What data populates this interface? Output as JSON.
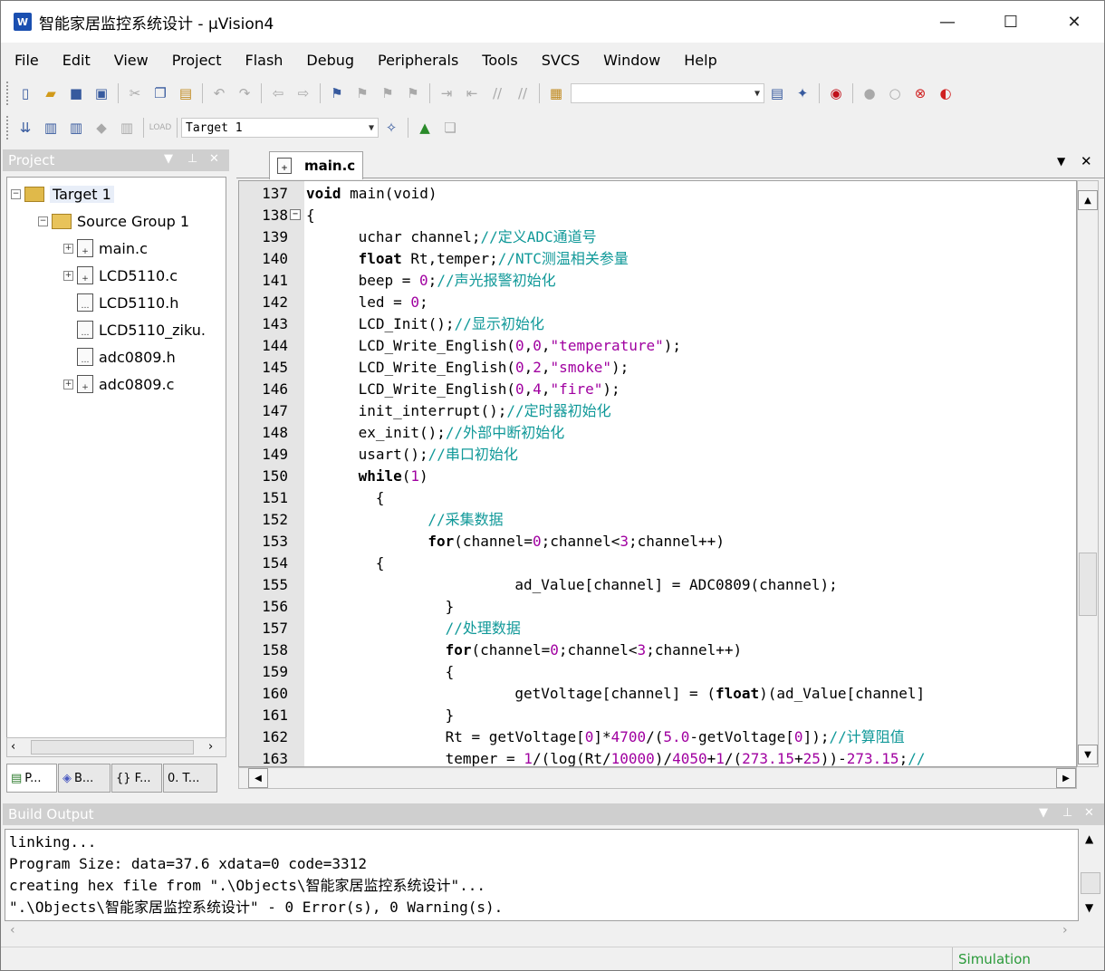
{
  "window": {
    "title": "智能家居监控系统设计  - µVision4",
    "minimize": "—",
    "maximize": "☐",
    "close": "✕"
  },
  "menu": [
    "File",
    "Edit",
    "View",
    "Project",
    "Flash",
    "Debug",
    "Peripherals",
    "Tools",
    "SVCS",
    "Window",
    "Help"
  ],
  "toolbar2": {
    "target": "Target 1"
  },
  "project_pane": {
    "title": "Project",
    "tree": [
      {
        "label": "Target 1",
        "level": 0,
        "expander": "−",
        "kind": "target"
      },
      {
        "label": "Source Group 1",
        "level": 1,
        "expander": "−",
        "kind": "folder"
      },
      {
        "label": "main.c",
        "level": 2,
        "expander": "+",
        "kind": "file"
      },
      {
        "label": "LCD5110.c",
        "level": 2,
        "expander": "+",
        "kind": "file"
      },
      {
        "label": "LCD5110.h",
        "level": 2,
        "expander": "",
        "kind": "file"
      },
      {
        "label": "LCD5110_ziku.",
        "level": 2,
        "expander": "",
        "kind": "file"
      },
      {
        "label": "adc0809.h",
        "level": 2,
        "expander": "",
        "kind": "file"
      },
      {
        "label": "adc0809.c",
        "level": 2,
        "expander": "+",
        "kind": "file"
      }
    ],
    "tabs": [
      "P...",
      "B...",
      "{} F...",
      "0. T..."
    ]
  },
  "editor": {
    "tab": "main.c",
    "lines": [
      {
        "n": "137",
        "indent": 0,
        "parts": [
          [
            "kw",
            "void "
          ],
          [
            "",
            "main(void)"
          ]
        ]
      },
      {
        "n": "138",
        "indent": 0,
        "fold": "−",
        "parts": [
          [
            "",
            "{"
          ]
        ]
      },
      {
        "n": "139",
        "indent": 6,
        "parts": [
          [
            "",
            "uchar channel;"
          ],
          [
            "cm",
            "//定义ADC通道号"
          ]
        ]
      },
      {
        "n": "140",
        "indent": 6,
        "parts": [
          [
            "kw",
            "float "
          ],
          [
            "",
            "Rt,temper;"
          ],
          [
            "cm",
            "//NTC测温相关参量"
          ]
        ]
      },
      {
        "n": "141",
        "indent": 6,
        "parts": [
          [
            "",
            "beep = "
          ],
          [
            "nm",
            "0"
          ],
          [
            "",
            ";"
          ],
          [
            "cm",
            "//声光报警初始化"
          ]
        ]
      },
      {
        "n": "142",
        "indent": 6,
        "parts": [
          [
            "",
            "led = "
          ],
          [
            "nm",
            "0"
          ],
          [
            "",
            ";"
          ]
        ]
      },
      {
        "n": "143",
        "indent": 6,
        "parts": [
          [
            "",
            "LCD_Init();"
          ],
          [
            "cm",
            "//显示初始化"
          ]
        ]
      },
      {
        "n": "144",
        "indent": 6,
        "parts": [
          [
            "",
            "LCD_Write_English("
          ],
          [
            "nm",
            "0"
          ],
          [
            "",
            ","
          ],
          [
            "nm",
            "0"
          ],
          [
            "",
            ","
          ],
          [
            "st",
            "\"temperature\""
          ],
          [
            "",
            ");"
          ]
        ]
      },
      {
        "n": "145",
        "indent": 6,
        "parts": [
          [
            "",
            "LCD_Write_English("
          ],
          [
            "nm",
            "0"
          ],
          [
            "",
            ","
          ],
          [
            "nm",
            "2"
          ],
          [
            "",
            ","
          ],
          [
            "st",
            "\"smoke\""
          ],
          [
            "",
            ");"
          ]
        ]
      },
      {
        "n": "146",
        "indent": 6,
        "parts": [
          [
            "",
            "LCD_Write_English("
          ],
          [
            "nm",
            "0"
          ],
          [
            "",
            ","
          ],
          [
            "nm",
            "4"
          ],
          [
            "",
            ","
          ],
          [
            "st",
            "\"fire\""
          ],
          [
            "",
            ");"
          ]
        ]
      },
      {
        "n": "147",
        "indent": 6,
        "parts": [
          [
            "",
            "init_interrupt();"
          ],
          [
            "cm",
            "//定时器初始化"
          ]
        ]
      },
      {
        "n": "148",
        "indent": 6,
        "parts": [
          [
            "",
            "ex_init();"
          ],
          [
            "cm",
            "//外部中断初始化"
          ]
        ]
      },
      {
        "n": "149",
        "indent": 6,
        "parts": [
          [
            "",
            "usart();"
          ],
          [
            "cm",
            "//串口初始化"
          ]
        ]
      },
      {
        "n": "150",
        "indent": 6,
        "parts": [
          [
            "kw",
            "while"
          ],
          [
            "",
            "("
          ],
          [
            "nm",
            "1"
          ],
          [
            "",
            ")"
          ]
        ]
      },
      {
        "n": "151",
        "indent": 8,
        "parts": [
          [
            "",
            "{"
          ]
        ]
      },
      {
        "n": "152",
        "indent": 14,
        "parts": [
          [
            "cm",
            "//采集数据"
          ]
        ]
      },
      {
        "n": "153",
        "indent": 14,
        "parts": [
          [
            "kw",
            "for"
          ],
          [
            "",
            "(channel="
          ],
          [
            "nm",
            "0"
          ],
          [
            "",
            ";channel<"
          ],
          [
            "nm",
            "3"
          ],
          [
            "",
            ";channel++)"
          ]
        ]
      },
      {
        "n": "154",
        "indent": 8,
        "parts": [
          [
            "",
            "{"
          ]
        ]
      },
      {
        "n": "155",
        "indent": 24,
        "parts": [
          [
            "",
            "ad_Value[channel] = ADC0809(channel);"
          ]
        ]
      },
      {
        "n": "156",
        "indent": 16,
        "parts": [
          [
            "",
            "}"
          ]
        ]
      },
      {
        "n": "157",
        "indent": 16,
        "parts": [
          [
            "cm",
            "//处理数据"
          ]
        ]
      },
      {
        "n": "158",
        "indent": 16,
        "parts": [
          [
            "kw",
            "for"
          ],
          [
            "",
            "(channel="
          ],
          [
            "nm",
            "0"
          ],
          [
            "",
            ";channel<"
          ],
          [
            "nm",
            "3"
          ],
          [
            "",
            ";channel++)"
          ]
        ]
      },
      {
        "n": "159",
        "indent": 16,
        "parts": [
          [
            "",
            "{"
          ]
        ]
      },
      {
        "n": "160",
        "indent": 24,
        "parts": [
          [
            "",
            "getVoltage[channel] = ("
          ],
          [
            "kw",
            "float"
          ],
          [
            "",
            ")(ad_Value[channel]"
          ]
        ]
      },
      {
        "n": "161",
        "indent": 16,
        "parts": [
          [
            "",
            "}"
          ]
        ]
      },
      {
        "n": "162",
        "indent": 16,
        "parts": [
          [
            "",
            "Rt = getVoltage["
          ],
          [
            "nm",
            "0"
          ],
          [
            "",
            "]*"
          ],
          [
            "nm",
            "4700"
          ],
          [
            "",
            "/("
          ],
          [
            "nm",
            "5.0"
          ],
          [
            "",
            "-getVoltage["
          ],
          [
            "nm",
            "0"
          ],
          [
            "",
            "]);"
          ],
          [
            "cm",
            "//计算阻值"
          ]
        ]
      },
      {
        "n": "163",
        "indent": 16,
        "parts": [
          [
            "",
            "temper = "
          ],
          [
            "nm",
            "1"
          ],
          [
            "",
            "/(log(Rt/"
          ],
          [
            "nm",
            "10000"
          ],
          [
            "",
            ")/"
          ],
          [
            "nm",
            "4050"
          ],
          [
            "",
            "+"
          ],
          [
            "nm",
            "1"
          ],
          [
            "",
            "/("
          ],
          [
            "nm",
            "273.15"
          ],
          [
            "",
            "+"
          ],
          [
            "nm",
            "25"
          ],
          [
            "",
            "))-"
          ],
          [
            "nm",
            "273.15"
          ],
          [
            "",
            ";"
          ],
          [
            "cm",
            "//"
          ]
        ]
      }
    ]
  },
  "build_output": {
    "title": "Build Output",
    "lines": [
      "linking...",
      "Program Size: data=37.6 xdata=0 code=3312",
      "creating hex file from \".\\Objects\\智能家居监控系统设计\"...",
      "\".\\Objects\\智能家居监控系统设计\" - 0 Error(s), 0 Warning(s)."
    ]
  },
  "status": {
    "mode": "Simulation"
  }
}
